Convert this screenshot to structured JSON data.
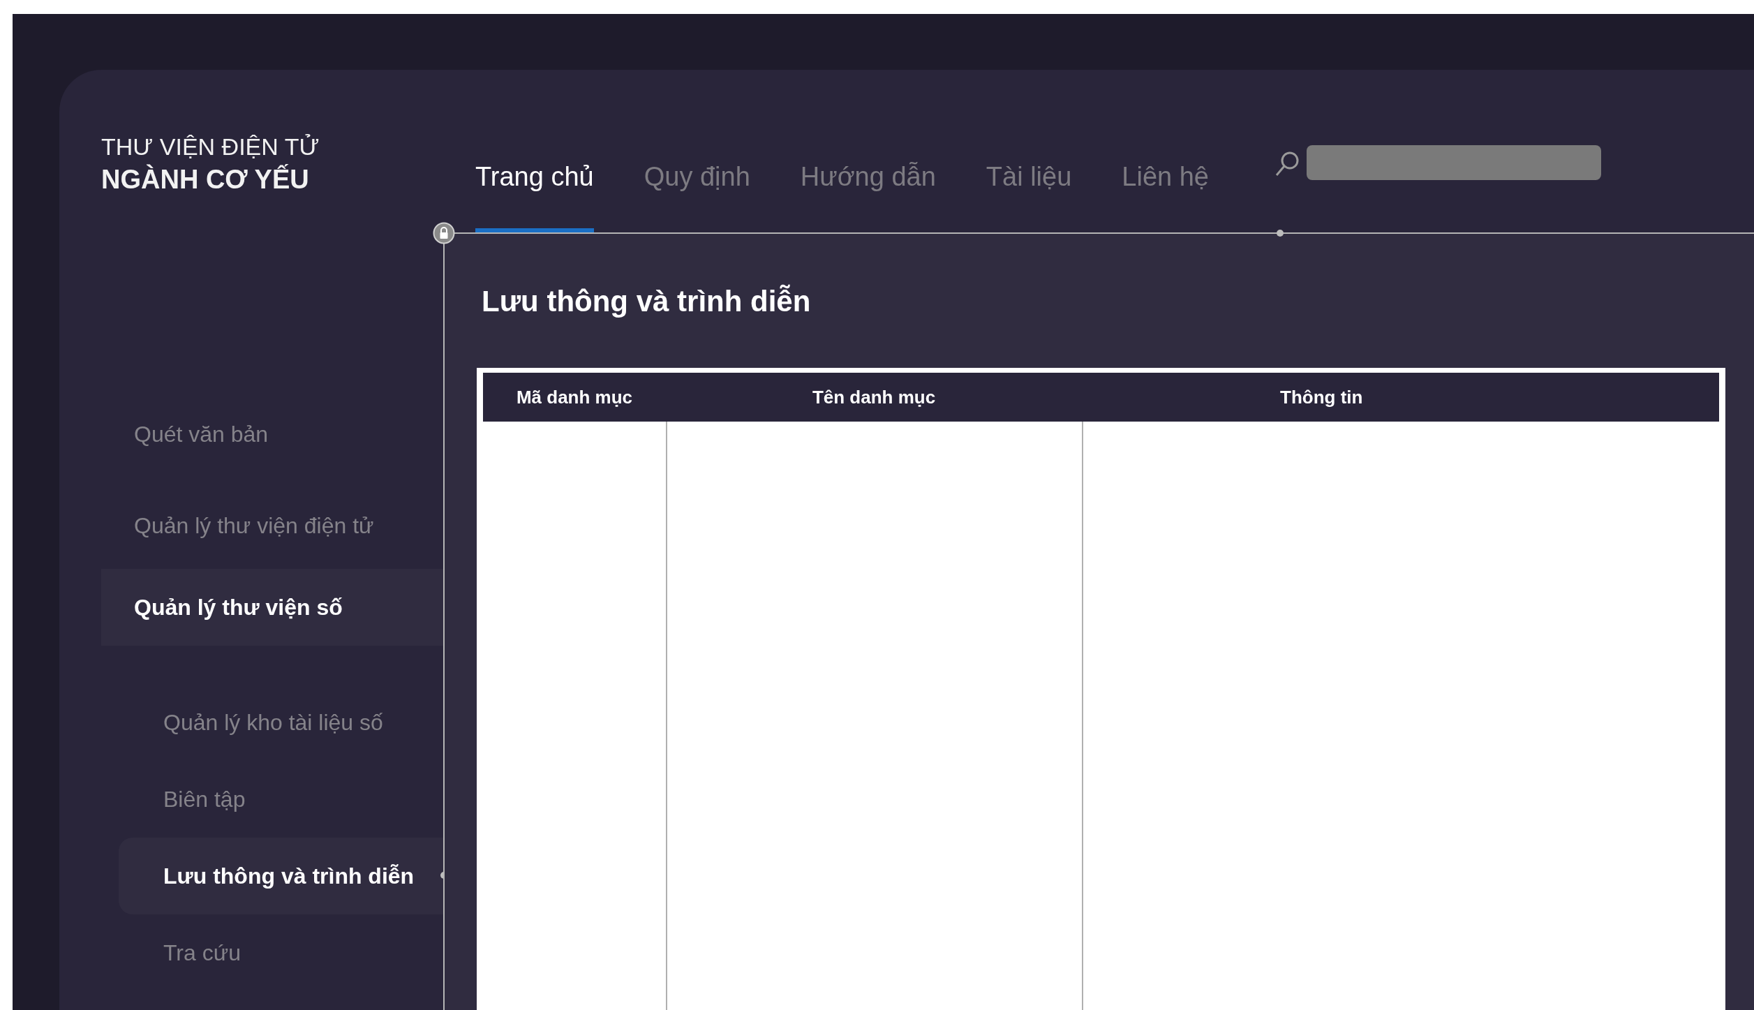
{
  "brand": {
    "line_1": "THƯ VIỆN ĐIỆN TỬ",
    "line_2": "NGÀNH CƠ YẾU"
  },
  "nav_tabs": [
    {
      "label": "Trang chủ",
      "selected": true
    },
    {
      "label": "Quy định",
      "selected": false
    },
    {
      "label": "Hướng dẫn",
      "selected": false
    },
    {
      "label": "Tài liệu",
      "selected": false
    },
    {
      "label": "Liên hệ",
      "selected": false
    }
  ],
  "sidebar": {
    "items": [
      {
        "label": "Quét văn bản",
        "selected": false
      },
      {
        "label": "Quản lý thư viện điện tử",
        "selected": false
      },
      {
        "label": "Quản lý thư viện số",
        "selected": true,
        "children": [
          {
            "label": "Quản lý kho tài liệu số",
            "selected": false
          },
          {
            "label": "Biên tập",
            "selected": false
          },
          {
            "label": "Lưu thông và trình diễn",
            "selected": true
          },
          {
            "label": "Tra cứu",
            "selected": false
          }
        ]
      }
    ]
  },
  "page_title": "Lưu thông và trình diễn",
  "table": {
    "columns": [
      "Mã danh mục",
      "Tên danh mục",
      "Thông tin"
    ]
  }
}
